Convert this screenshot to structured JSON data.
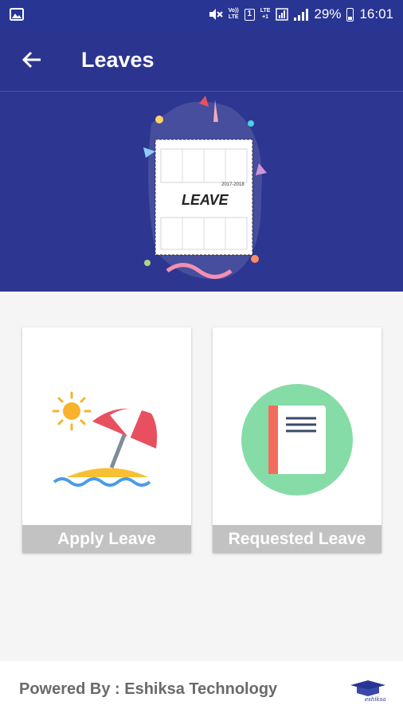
{
  "status_bar": {
    "volte_top": "Vo))",
    "volte_bottom": "LTE",
    "sim_badge": "1",
    "network": "LTE",
    "network_sub": "+1",
    "battery_percent": "29%",
    "time": "16:01"
  },
  "header": {
    "title": "Leaves"
  },
  "banner": {
    "calendar_year": "2017-2018",
    "calendar_word": "LEAVE"
  },
  "cards": [
    {
      "label": "Apply Leave",
      "icon": "beach-umbrella-icon"
    },
    {
      "label": "Requested Leave",
      "icon": "notebook-icon"
    }
  ],
  "footer": {
    "powered_by": "Powered By : Eshiksa Technology",
    "logo_text": "eshiksa"
  },
  "colors": {
    "primary": "#283593",
    "banner_bg": "#2d3690",
    "card_label_bg": "#c2c2c2",
    "notebook_circle": "#86dca6",
    "umbrella_red": "#e9505f",
    "sun": "#f7b32b",
    "sea": "#4a9ce8"
  }
}
